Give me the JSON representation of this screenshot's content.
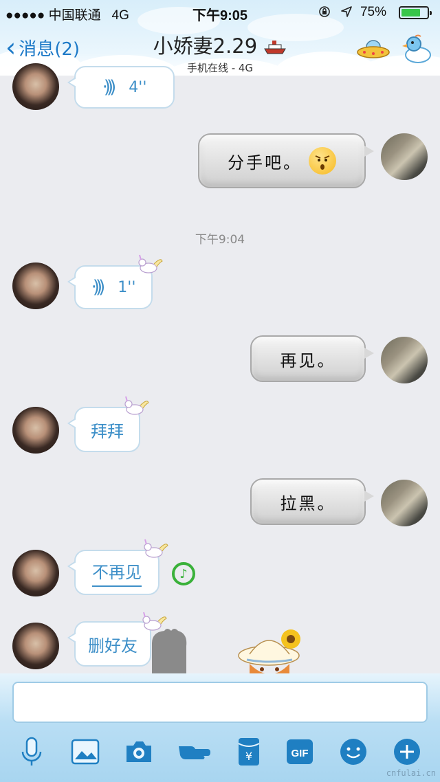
{
  "status_bar": {
    "carrier": "●●●●● 中国联通",
    "network": "4G",
    "time": "下午9:05",
    "battery_text": "75%",
    "battery_level": 0.75,
    "battery_color": "#38c64a"
  },
  "header": {
    "back_label": "消息(2)",
    "title": "小娇妻2.29",
    "subtitle": "手机在线 - 4G",
    "accent_color": "#1c79c7"
  },
  "messages": [
    {
      "side": "left",
      "type": "voice",
      "duration": "4''"
    },
    {
      "side": "right",
      "type": "text",
      "text": "分手吧。"
    },
    {
      "type": "timestamp",
      "text": "下午9:04"
    },
    {
      "side": "left",
      "type": "voice",
      "duration": "1''"
    },
    {
      "side": "right",
      "type": "text",
      "text": "再见。"
    },
    {
      "side": "left",
      "type": "text",
      "text": "拜拜"
    },
    {
      "side": "right",
      "type": "text",
      "text": "拉黑。"
    },
    {
      "side": "left",
      "type": "text",
      "text": "不再见"
    },
    {
      "side": "left",
      "type": "text",
      "text": "删好友"
    }
  ],
  "input": {
    "placeholder": ""
  },
  "toolbar": {
    "icons": [
      "microphone-icon",
      "image-icon",
      "camera-icon",
      "poke-icon",
      "red-packet-icon",
      "gif-icon",
      "emoji-icon",
      "plus-icon"
    ],
    "gif_label": "GIF",
    "red_packet_label": "¥"
  },
  "watermark": "cnfulai.cn"
}
